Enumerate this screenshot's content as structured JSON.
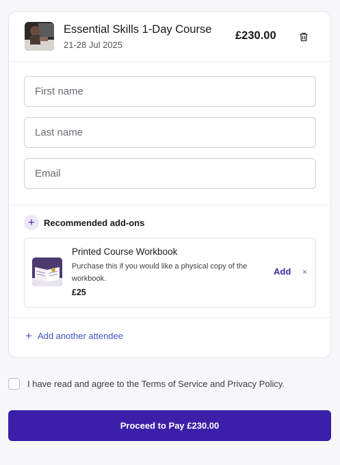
{
  "course": {
    "title": "Essential Skills 1-Day Course",
    "dates": "21-28 Jul 2025",
    "price": "£230.00",
    "icons": {
      "thumbnail": "course-thumbnail-photo",
      "remove": "trash-icon"
    }
  },
  "form": {
    "first_name_placeholder": "First name",
    "first_name_value": "",
    "last_name_placeholder": "Last name",
    "last_name_value": "",
    "email_placeholder": "Email",
    "email_value": ""
  },
  "addons": {
    "section_title": "Recommended add-ons",
    "section_icon": "plus-icon",
    "items": [
      {
        "name": "Printed Course Workbook",
        "description": "Purchase this if you would like a physical copy of the workbook.",
        "price": "£25",
        "add_label": "Add",
        "dismiss_label": "×",
        "icon": "workbook-thumbnail"
      }
    ]
  },
  "add_attendee": {
    "icon": "+",
    "label": "Add another attendee"
  },
  "terms": {
    "checked": false,
    "label": "I have read and agree to the Terms of Service and Privacy Policy."
  },
  "pay_button": {
    "label": "Proceed to Pay £230.00"
  },
  "colors": {
    "accent": "#3b1fa8",
    "link": "#3e54c6",
    "border": "#e3e3e8"
  }
}
